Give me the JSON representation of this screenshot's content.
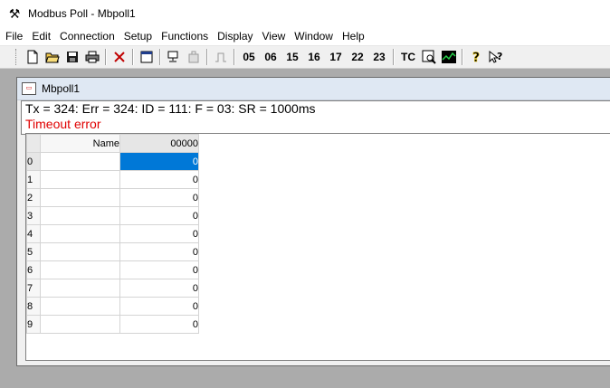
{
  "window": {
    "title": "Modbus Poll - Mbpoll1"
  },
  "menu": [
    "File",
    "Edit",
    "Connection",
    "Setup",
    "Functions",
    "Display",
    "View",
    "Window",
    "Help"
  ],
  "toolbar": {
    "new_icon": "new-document-icon",
    "open_icon": "open-folder-icon",
    "save_icon": "save-disk-icon",
    "print_icon": "printer-icon",
    "delete_icon": "close-x-icon",
    "window_icon": "window-icon",
    "read_write_icon": "connect-icon",
    "disconnect_icon": "disconnect-icon",
    "pulse_icon": "pulse-icon",
    "function_codes": [
      "05",
      "06",
      "15",
      "16",
      "17",
      "22",
      "23"
    ],
    "tc_label": "TC",
    "help_icon": "help-icon",
    "context_help_icon": "context-help-icon"
  },
  "child": {
    "title": "Mbpoll1",
    "status_line": "Tx = 324: Err = 324: ID = 111: F = 03: SR = 1000ms",
    "error_text": "Timeout error"
  },
  "grid": {
    "name_header": "Name",
    "address_header": "00000",
    "rows": [
      {
        "index": "0",
        "name": "",
        "value": "0"
      },
      {
        "index": "1",
        "name": "",
        "value": "0"
      },
      {
        "index": "2",
        "name": "",
        "value": "0"
      },
      {
        "index": "3",
        "name": "",
        "value": "0"
      },
      {
        "index": "4",
        "name": "",
        "value": "0"
      },
      {
        "index": "5",
        "name": "",
        "value": "0"
      },
      {
        "index": "6",
        "name": "",
        "value": "0"
      },
      {
        "index": "7",
        "name": "",
        "value": "0"
      },
      {
        "index": "8",
        "name": "",
        "value": "0"
      },
      {
        "index": "9",
        "name": "",
        "value": "0"
      }
    ],
    "selected_row": 0
  },
  "colors": {
    "selection": "#0078d7",
    "error": "#e00000",
    "mdi_background": "#ababab"
  }
}
